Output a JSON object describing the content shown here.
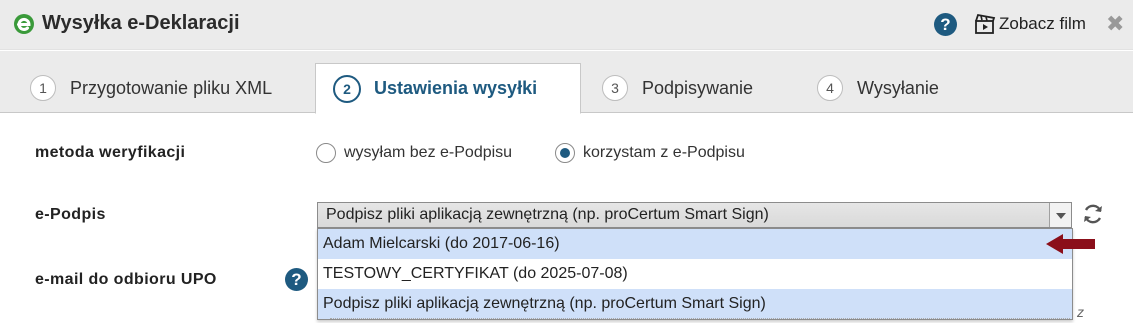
{
  "window": {
    "title": "Wysyłka e-Deklaracji",
    "help_icon": "?",
    "film_label": "Zobacz film",
    "close_icon": "✖"
  },
  "tabs": [
    {
      "number": "1",
      "label": "Przygotowanie pliku XML",
      "active": false
    },
    {
      "number": "2",
      "label": "Ustawienia wysyłki",
      "active": true
    },
    {
      "number": "3",
      "label": "Podpisywanie",
      "active": false
    },
    {
      "number": "4",
      "label": "Wysyłanie",
      "active": false
    }
  ],
  "form": {
    "verification": {
      "label": "metoda weryfikacji",
      "options": [
        {
          "label": "wysyłam bez e-Podpisu",
          "checked": false
        },
        {
          "label": "korzystam z e-Podpisu",
          "checked": true
        }
      ]
    },
    "epodpis": {
      "label": "e-Podpis",
      "selected": "Podpisz pliki aplikacją zewnętrzną (np. proCertum Smart Sign)",
      "options": [
        {
          "label": "Adam Mielcarski (do 2017-06-16)",
          "highlighted": true
        },
        {
          "label": "TESTOWY_CERTYFIKAT (do 2025-07-08)",
          "highlighted": false
        },
        {
          "label": "Podpisz pliki aplikacją zewnętrzną (np. proCertum Smart Sign)",
          "highlighted": true
        }
      ]
    },
    "upo_email": {
      "label": "e-mail do odbioru UPO",
      "help_icon": "?",
      "trailing_text": "z"
    }
  },
  "colors": {
    "accent": "#1e5a80",
    "highlight": "#cfe0f9",
    "pointer_arrow": "#8b0f1a",
    "logo_green": "#3a9a3a"
  },
  "icons": [
    "app-logo-icon",
    "help-icon",
    "film-clapper-icon",
    "close-icon",
    "chevron-down-icon",
    "refresh-icon",
    "pointer-arrow-icon"
  ]
}
